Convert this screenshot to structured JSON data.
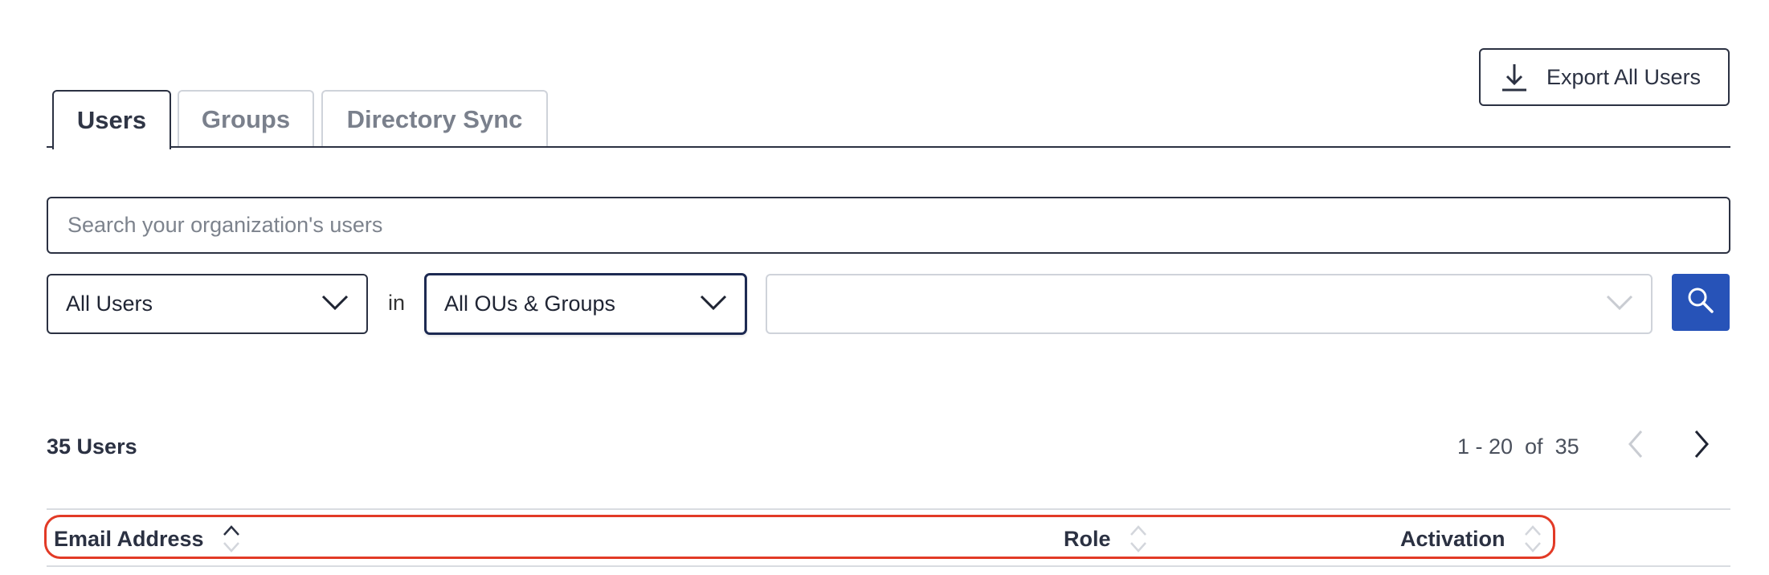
{
  "toolbar": {
    "export_label": "Export All Users",
    "export_icon": "download-icon"
  },
  "tabs": [
    {
      "label": "Users",
      "active": true
    },
    {
      "label": "Groups",
      "active": false
    },
    {
      "label": "Directory Sync",
      "active": false
    }
  ],
  "search": {
    "placeholder": "Search your organization's users",
    "value": ""
  },
  "filters": {
    "user_type": "All Users",
    "connector": "in",
    "scope": "All OUs & Groups",
    "value": ""
  },
  "results": {
    "count_label": "35 Users",
    "page_range": "1 - 20  of  35"
  },
  "table": {
    "columns": [
      {
        "label": "Email Address",
        "sort": "asc"
      },
      {
        "label": "Role",
        "sort": "none"
      },
      {
        "label": "Activation",
        "sort": "none"
      }
    ]
  },
  "colors": {
    "primary": "#2753b8",
    "border_dark": "#2b3142",
    "highlight": "#e23a26"
  }
}
